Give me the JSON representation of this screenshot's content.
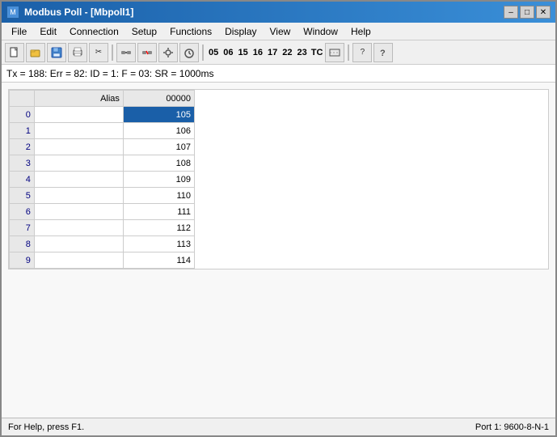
{
  "window": {
    "title": "Modbus Poll - [Mbpoll1]",
    "icon": "📊"
  },
  "title_buttons": {
    "minimize": "–",
    "maximize": "□",
    "close": "✕"
  },
  "menu": {
    "items": [
      "File",
      "Edit",
      "Connection",
      "Setup",
      "Functions",
      "Display",
      "View",
      "Window",
      "Help"
    ]
  },
  "toolbar": {
    "numbers": [
      "05",
      "06",
      "15",
      "16",
      "17",
      "22",
      "23"
    ],
    "labels": [
      "TC"
    ]
  },
  "status_line": {
    "text": "Tx = 188: Err = 82: ID = 1: F = 03: SR = 1000ms"
  },
  "table": {
    "col_alias": "Alias",
    "col_value": "00000",
    "rows": [
      {
        "index": "0",
        "alias": "",
        "value": "105",
        "selected": true
      },
      {
        "index": "1",
        "alias": "",
        "value": "106",
        "selected": false
      },
      {
        "index": "2",
        "alias": "",
        "value": "107",
        "selected": false
      },
      {
        "index": "3",
        "alias": "",
        "value": "108",
        "selected": false
      },
      {
        "index": "4",
        "alias": "",
        "value": "109",
        "selected": false
      },
      {
        "index": "5",
        "alias": "",
        "value": "110",
        "selected": false
      },
      {
        "index": "6",
        "alias": "",
        "value": "111",
        "selected": false
      },
      {
        "index": "7",
        "alias": "",
        "value": "112",
        "selected": false
      },
      {
        "index": "8",
        "alias": "",
        "value": "113",
        "selected": false
      },
      {
        "index": "9",
        "alias": "",
        "value": "114",
        "selected": false
      }
    ]
  },
  "status_bar": {
    "help_text": "For Help, press F1.",
    "port_text": "Port 1: 9600-8-N-1"
  }
}
